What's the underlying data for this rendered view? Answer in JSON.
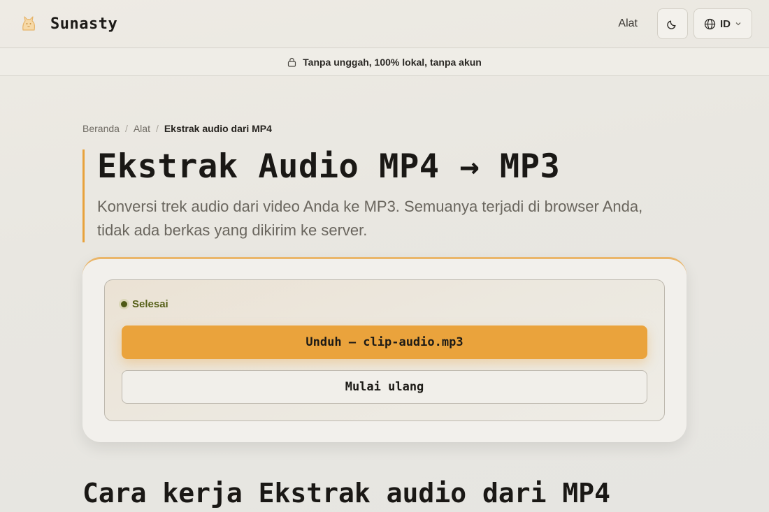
{
  "brand": {
    "name": "Sunasty",
    "logo_icon": "cat-icon"
  },
  "nav": {
    "tools_label": "Alat",
    "theme_icon": "moon-icon",
    "language_label": "ID"
  },
  "banner": {
    "text": "Tanpa unggah, 100% lokal, tanpa akun",
    "icon": "lock-icon"
  },
  "breadcrumb": {
    "home": "Beranda",
    "tools": "Alat",
    "current": "Ekstrak audio dari MP4"
  },
  "hero": {
    "title": "Ekstrak Audio MP4 → MP3",
    "description": "Konversi trek audio dari video Anda ke MP3. Semuanya terjadi di browser Anda, tidak ada berkas yang dikirim ke server."
  },
  "result": {
    "status": "Selesai",
    "download_label": "Unduh — clip-audio.mp3",
    "restart_label": "Mulai ulang"
  },
  "section": {
    "title": "Cara kerja Ekstrak audio dari MP4"
  },
  "colors": {
    "accent": "#eaa33c",
    "success": "#4e5a16",
    "background": "#e9e7e1"
  }
}
